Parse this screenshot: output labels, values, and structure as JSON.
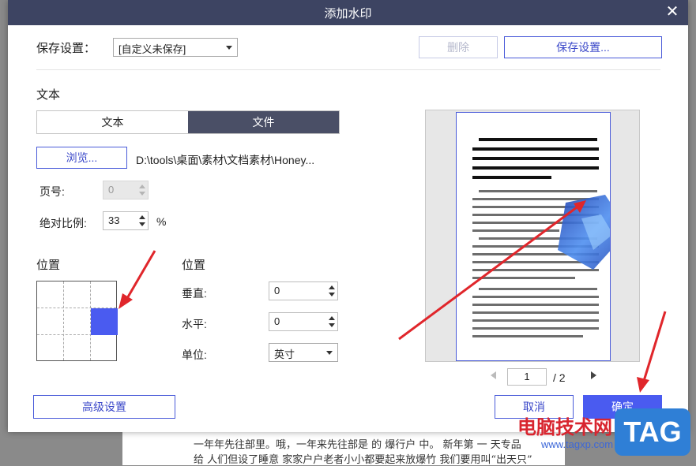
{
  "backdrop": {
    "line1": "一年年先往部里。哦，一年来先往部是 的 爆行户 中。 新年第 一 天专品",
    "line2": "给 人们但设了睡意 家家户户老者小小都要起来放爆竹 我们要用叫“出天只”"
  },
  "dialog": {
    "title": "添加水印",
    "close_label": "✕",
    "save_settings": {
      "label": "保存设置：",
      "selected": "[自定义未保存]",
      "delete_label": "删除",
      "save_label": "保存设置..."
    },
    "text_section": {
      "heading": "文本",
      "tabs": [
        {
          "label": "文本",
          "active": false
        },
        {
          "label": "文件",
          "active": true
        }
      ],
      "browse_label": "浏览...",
      "file_path": "D:\\tools\\桌面\\素材\\文档素材\\Honey...",
      "page_label": "页号:",
      "page_value": "0",
      "scale_label": "绝对比例:",
      "scale_value": "33",
      "scale_unit": "%"
    },
    "position_grid": {
      "heading": "位置",
      "selected_row": 2,
      "selected_col": 3
    },
    "position_fields": {
      "heading": "位置",
      "vertical_label": "垂直:",
      "vertical_value": "0",
      "horizontal_label": "水平:",
      "horizontal_value": "0",
      "unit_label": "单位:",
      "unit_value": "英寸"
    },
    "preview": {
      "current_page": "1",
      "total_pages": "/ 2",
      "prev_icon": "caret-left-icon",
      "next_icon": "caret-right-icon"
    },
    "advanced_label": "高级设置",
    "cancel_label": "取消",
    "ok_label": "确定"
  },
  "watermark_site": {
    "name": "电脑技术网",
    "url": "www.tagxp.com",
    "badge": "TAG"
  },
  "colors": {
    "titlebar": "#3d4462",
    "accent": "#4a5bf0",
    "annotation": "#e0262b"
  }
}
